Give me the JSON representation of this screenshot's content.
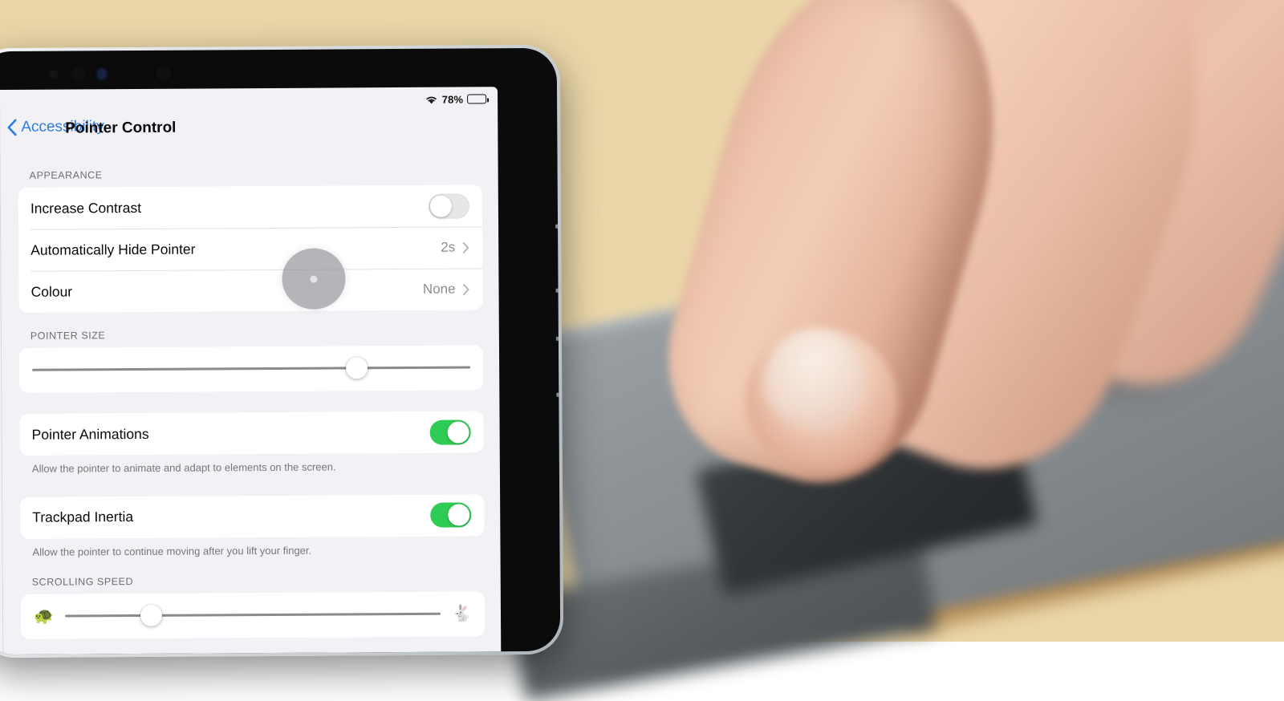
{
  "device": {
    "name": "ipad-tablet",
    "sensors": [
      "ambient-light-sensor",
      "front-camera",
      "status-led",
      "face-id-sensor"
    ]
  },
  "status_bar": {
    "wifi_icon": "wifi-icon",
    "battery_percent": "78%",
    "battery_level": 78,
    "battery_icon": "battery-icon"
  },
  "nav": {
    "back_icon": "chevron-left-icon",
    "back_label": "Accessibility",
    "title": "Pointer Control"
  },
  "pointer_overlay": {
    "name": "pointer-cursor",
    "color": "#787880",
    "opacity": 0.55
  },
  "sections": {
    "appearance": {
      "header": "APPEARANCE",
      "rows": [
        {
          "label": "Increase Contrast",
          "control": "toggle",
          "value": "off"
        },
        {
          "label": "Automatically Hide Pointer",
          "control": "disclosure",
          "value": "2s"
        },
        {
          "label": "Colour",
          "control": "disclosure",
          "value": "None"
        }
      ]
    },
    "pointer_size": {
      "header": "POINTER SIZE",
      "slider": {
        "name": "pointer-size-slider",
        "percent": 74
      }
    },
    "pointer_animations": {
      "label": "Pointer Animations",
      "value": "on",
      "footnote": "Allow the pointer to animate and adapt to elements on the screen."
    },
    "trackpad_inertia": {
      "label": "Trackpad Inertia",
      "value": "on",
      "footnote": "Allow the pointer to continue moving after you lift your finger."
    },
    "scrolling_speed": {
      "header": "SCROLLING SPEED",
      "slow_icon": "turtle-icon",
      "slow_glyph": "🐢",
      "fast_icon": "rabbit-icon",
      "fast_glyph": "🐇",
      "slider": {
        "name": "scrolling-speed-slider",
        "percent": 23
      }
    }
  },
  "colors": {
    "accent_blue": "#2f7ce0",
    "toggle_on_green": "#2fcc55",
    "screen_background": "#f1f1f6",
    "card_white": "#ffffff",
    "secondary_text": "#8c8c92"
  }
}
